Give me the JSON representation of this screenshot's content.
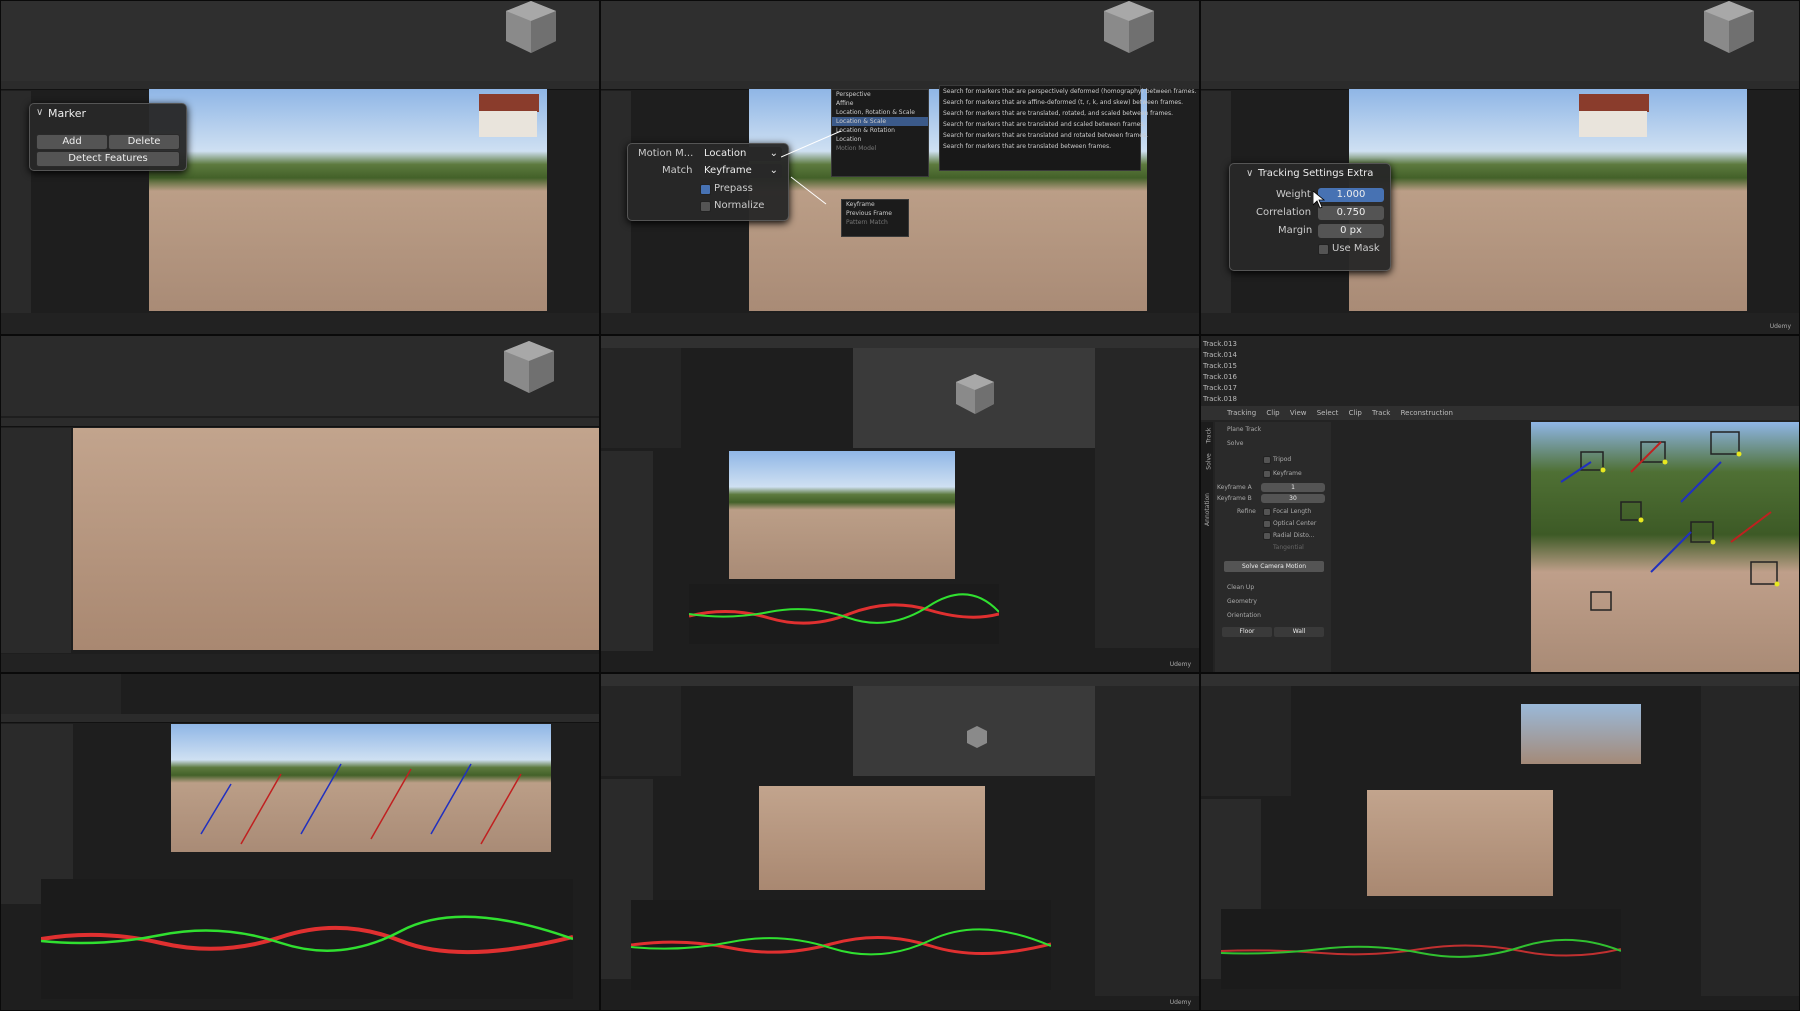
{
  "tile1": {
    "panel_title": "Marker",
    "add_label": "Add",
    "delete_label": "Delete",
    "detect_label": "Detect Features"
  },
  "tile2": {
    "motion_label": "Motion M...",
    "motion_value": "Location",
    "match_label": "Match",
    "match_value": "Keyframe",
    "prepass_label": "Prepass",
    "normalize_label": "Normalize",
    "motion_options": [
      "Perspective",
      "Affine",
      "Location, Rotation & Scale",
      "Location & Scale",
      "Location & Rotation",
      "Location",
      "Motion Model"
    ],
    "motion_descriptions": [
      "Search for markers that are perspectively deformed (homography) between frames.",
      "Search for markers that are affine-deformed (t, r, k, and skew) between frames.",
      "Search for markers that are translated, rotated, and scaled between frames.",
      "Search for markers that are translated and scaled between frames.",
      "Search for markers that are translated and rotated between frames.",
      "Search for markers that are translated between frames."
    ],
    "match_options": [
      "Keyframe",
      "Previous Frame",
      "Pattern Match"
    ]
  },
  "tile3": {
    "panel_title": "Tracking Settings Extra",
    "weight_label": "Weight",
    "weight_value": "1.000",
    "correlation_label": "Correlation",
    "correlation_value": "0.750",
    "margin_label": "Margin",
    "margin_value": "0 px",
    "mask_label": "Use Mask"
  },
  "tile6": {
    "tracks": [
      "Track.013",
      "Track.014",
      "Track.015",
      "Track.016",
      "Track.017",
      "Track.018"
    ],
    "menu": [
      "Tracking",
      "Clip",
      "View",
      "Select",
      "Clip",
      "Track",
      "Reconstruction"
    ],
    "vertical_tabs": [
      "Solve",
      "Track",
      "Annotation"
    ],
    "plane_track": "Plane Track",
    "solve": "Solve",
    "tripod": "Tripod",
    "keyframe": "Keyframe",
    "keyframe_a_label": "Keyframe A",
    "keyframe_a_value": "1",
    "keyframe_b_label": "Keyframe B",
    "keyframe_b_value": "30",
    "refine_label": "Refine",
    "focal_length": "Focal Length",
    "optical_center": "Optical Center",
    "radial_distortion": "Radial Disto...",
    "tangential": "Tangential",
    "solve_button": "Solve Camera Motion",
    "clean_up": "Clean Up",
    "geometry": "Geometry",
    "orientation": "Orientation",
    "floor": "Floor",
    "wall": "Wall"
  },
  "watermark": "Udemy"
}
